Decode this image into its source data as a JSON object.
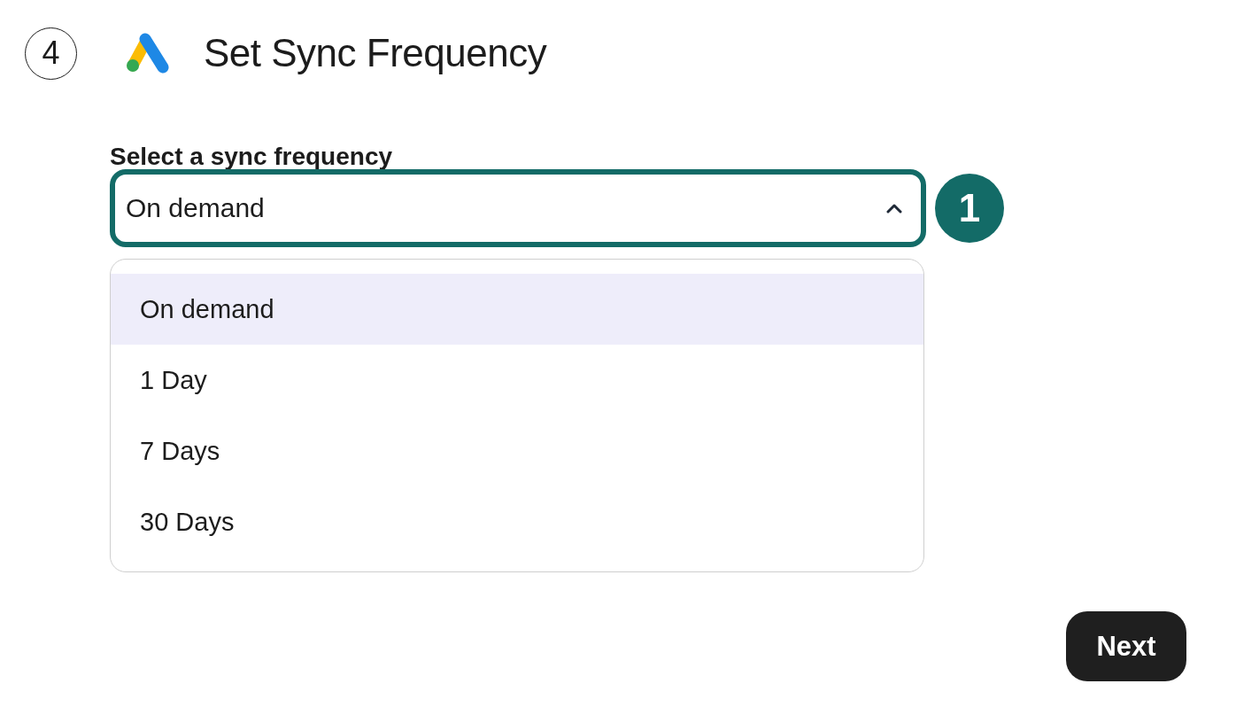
{
  "step": "4",
  "title": "Set Sync Frequency",
  "field": {
    "label": "Select a sync frequency",
    "value": "On demand",
    "expanded": true
  },
  "marker": "1",
  "options": [
    {
      "label": "On demand",
      "selected": true
    },
    {
      "label": "1 Day",
      "selected": false
    },
    {
      "label": "7 Days",
      "selected": false
    },
    {
      "label": "30 Days",
      "selected": false
    }
  ],
  "next_button": "Next"
}
